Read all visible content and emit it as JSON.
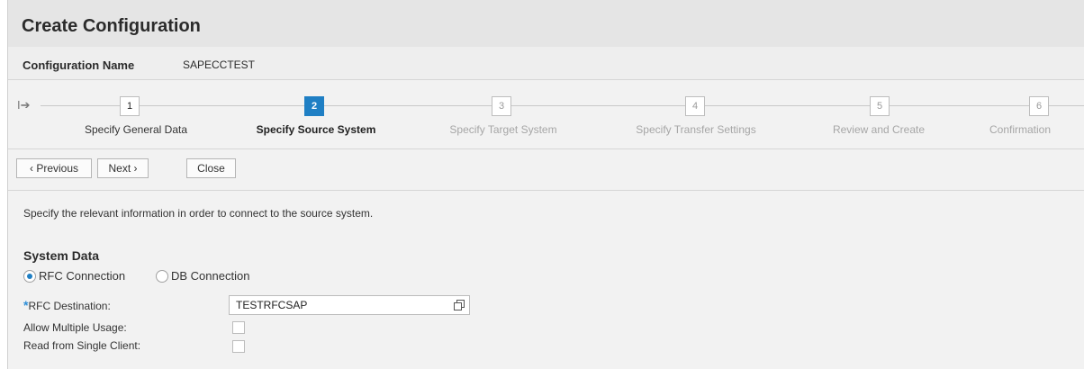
{
  "header": {
    "title": "Create Configuration"
  },
  "config": {
    "label": "Configuration Name",
    "value": "SAPECCTEST"
  },
  "wizard": {
    "steps": [
      {
        "num": "1",
        "label": "Specify General Data",
        "state": "done"
      },
      {
        "num": "2",
        "label": "Specify Source System",
        "state": "active"
      },
      {
        "num": "3",
        "label": "Specify Target System",
        "state": "disabled"
      },
      {
        "num": "4",
        "label": "Specify Transfer Settings",
        "state": "disabled"
      },
      {
        "num": "5",
        "label": "Review and Create",
        "state": "disabled"
      },
      {
        "num": "6",
        "label": "Confirmation",
        "state": "disabled"
      }
    ]
  },
  "toolbar": {
    "previous": "‹ Previous",
    "next": "Next ›",
    "close": "Close"
  },
  "content": {
    "intro": "Specify the relevant information in order to connect to the source system.",
    "section_title": "System Data",
    "radios": {
      "rfc": "RFC Connection",
      "db": "DB Connection",
      "selected": "rfc"
    },
    "fields": {
      "rfc_destination": {
        "label": "RFC Destination:",
        "value": "TESTRFCSAP",
        "required": true
      },
      "allow_multiple_usage": {
        "label": "Allow Multiple Usage:",
        "checked": false
      },
      "read_single_client": {
        "label": "Read from Single Client:",
        "checked": false
      }
    }
  },
  "colors": {
    "accent": "#1f7fc4",
    "required": "#2f8fd8"
  }
}
